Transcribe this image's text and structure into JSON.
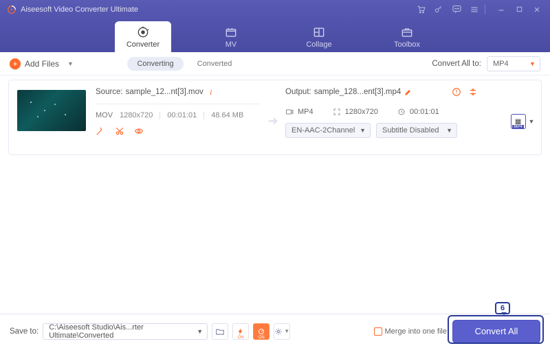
{
  "titlebar": {
    "title": "Aiseesoft Video Converter Ultimate"
  },
  "tabs": {
    "converter": "Converter",
    "mv": "MV",
    "collage": "Collage",
    "toolbox": "Toolbox"
  },
  "subbar": {
    "add_files": "Add Files",
    "converting": "Converting",
    "converted": "Converted",
    "convert_all_to": "Convert All to:",
    "format": "MP4"
  },
  "file": {
    "source_label": "Source:",
    "source_name": "sample_12...nt[3].mov",
    "src_fmt": "MOV",
    "src_res": "1280x720",
    "src_dur": "00:01:01",
    "src_size": "48.64 MB",
    "output_label": "Output:",
    "output_name": "sample_128...ent[3].mp4",
    "out_fmt": "MP4",
    "out_res": "1280x720",
    "out_dur": "00:01:01",
    "audio_dd": "EN-AAC-2Channel",
    "sub_dd": "Subtitle Disabled",
    "profile_tag": "MP4"
  },
  "footer": {
    "save_to": "Save to:",
    "path": "C:\\Aiseesoft Studio\\Ais...rter Ultimate\\Converted",
    "merge": "Merge into one file",
    "convert_all": "Convert All",
    "callout": "6"
  }
}
